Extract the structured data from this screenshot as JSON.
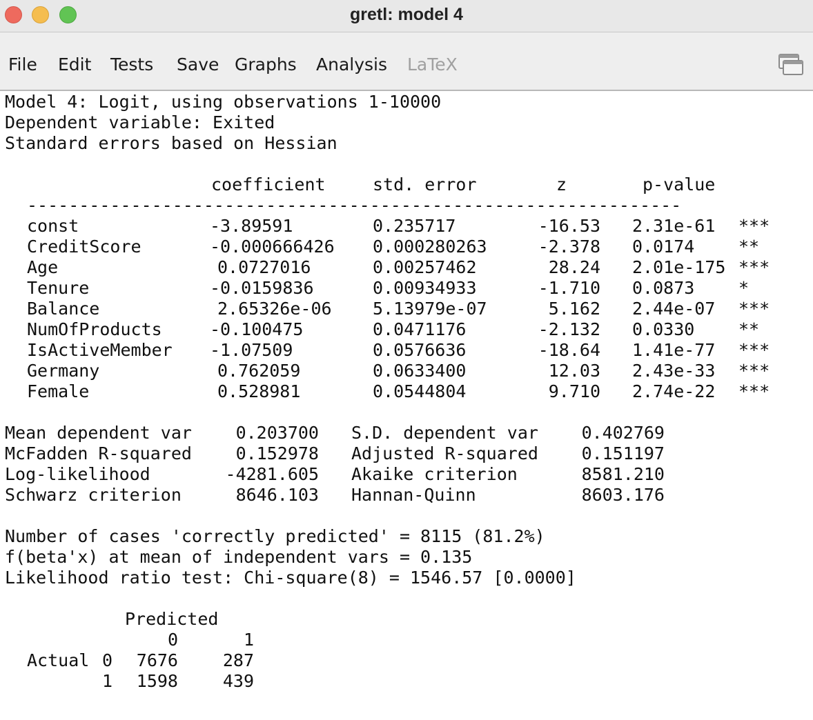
{
  "window": {
    "title": "gretl: model 4",
    "controls": [
      "close",
      "minimize",
      "maximize"
    ]
  },
  "menu": {
    "items": [
      {
        "label": "File",
        "enabled": true
      },
      {
        "label": "Edit",
        "enabled": true
      },
      {
        "label": "Tests",
        "enabled": true
      },
      {
        "label": "Save",
        "enabled": true
      },
      {
        "label": "Graphs",
        "enabled": true
      },
      {
        "label": "Analysis",
        "enabled": true
      },
      {
        "label": "LaTeX",
        "enabled": false
      }
    ],
    "right_icon": "detach-window-icon"
  },
  "output": {
    "header": [
      "Model 4: Logit, using observations 1-10000",
      "Dependent variable: Exited",
      "Standard errors based on Hessian"
    ],
    "table": {
      "columns": [
        "coefficient",
        "std. error",
        "z",
        "p-value"
      ],
      "rows": [
        {
          "name": "const",
          "coef": "-3.89591",
          "se": "0.235717",
          "z": "-16.53",
          "p": "2.31e-61",
          "sig": "***"
        },
        {
          "name": "CreditScore",
          "coef": "-0.000666426",
          "se": "0.000280263",
          "z": "-2.378",
          "p": "0.0174",
          "sig": "**"
        },
        {
          "name": "Age",
          "coef": "0.0727016",
          "se": "0.00257462",
          "z": "28.24",
          "p": "2.01e-175",
          "sig": "***"
        },
        {
          "name": "Tenure",
          "coef": "-0.0159836",
          "se": "0.00934933",
          "z": "-1.710",
          "p": "0.0873",
          "sig": "*"
        },
        {
          "name": "Balance",
          "coef": "2.65326e-06",
          "se": "5.13979e-07",
          "z": "5.162",
          "p": "2.44e-07",
          "sig": "***"
        },
        {
          "name": "NumOfProducts",
          "coef": "-0.100475",
          "se": "0.0471176",
          "z": "-2.132",
          "p": "0.0330",
          "sig": "**"
        },
        {
          "name": "IsActiveMember",
          "coef": "-1.07509",
          "se": "0.0576636",
          "z": "-18.64",
          "p": "1.41e-77",
          "sig": "***"
        },
        {
          "name": "Germany",
          "coef": "0.762059",
          "se": "0.0633400",
          "z": "12.03",
          "p": "2.43e-33",
          "sig": "***"
        },
        {
          "name": "Female",
          "coef": "0.528981",
          "se": "0.0544804",
          "z": "9.710",
          "p": "2.74e-22",
          "sig": "***"
        }
      ]
    },
    "stats": [
      {
        "label1": "Mean dependent var",
        "value1": "0.203700",
        "label2": "S.D. dependent var",
        "value2": "0.402769"
      },
      {
        "label1": "McFadden R-squared",
        "value1": "0.152978",
        "label2": "Adjusted R-squared",
        "value2": "0.151197"
      },
      {
        "label1": "Log-likelihood",
        "value1": "-4281.605",
        "label2": "Akaike criterion",
        "value2": "8581.210"
      },
      {
        "label1": "Schwarz criterion",
        "value1": "8646.103",
        "label2": "Hannan-Quinn",
        "value2": "8603.176"
      }
    ],
    "notes": [
      "Number of cases 'correctly predicted' = 8115 (81.2%)",
      "f(beta'x) at mean of independent vars = 0.135",
      "Likelihood ratio test: Chi-square(8) = 1546.57 [0.0000]"
    ],
    "confusion": {
      "predicted_label": "Predicted",
      "col_headers": [
        "0",
        "1"
      ],
      "actual_label": "Actual",
      "rows": [
        {
          "actual": "0",
          "values": [
            "7676",
            "287"
          ]
        },
        {
          "actual": "1",
          "values": [
            "1598",
            "439"
          ]
        }
      ]
    }
  }
}
